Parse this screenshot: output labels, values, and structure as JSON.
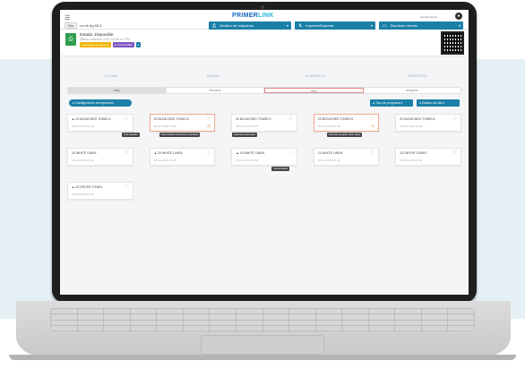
{
  "app": {
    "brand_prefix": "PRIMER",
    "brand_suffix": "LINK",
    "user_name": "Usuario Demo",
    "user_initial": "●"
  },
  "toolbar": {
    "store_label": "Sitio",
    "store_value": "La de Ag 80.4",
    "buttons": [
      {
        "label": "Gestión de máquinas",
        "icon": "printer-icon"
      },
      {
        "label": "Importar/Exportar",
        "icon": "exchange-icon"
      },
      {
        "label": "Escritorio remoto",
        "icon": "monitor-icon"
      }
    ]
  },
  "status": {
    "title": "Estado: Disponible",
    "subtitle": "Última conexión 2021-02-05 a 4 PM",
    "badges": [
      {
        "label": "● Etiquetas de ejemplo",
        "color": "#f4b400"
      },
      {
        "label": "● Cola de PED",
        "color": "#7e57c2"
      },
      {
        "label": "●",
        "color": "#1b7fa8"
      }
    ]
  },
  "sections": [
    "COCINA",
    "MENÚS",
    "ALIMENTOS",
    "REPORTES"
  ],
  "tabs": [
    {
      "label": "Hoy",
      "state": "active"
    },
    {
      "label": "Semana",
      "state": ""
    },
    {
      "label": "Mes",
      "state": "sel"
    },
    {
      "label": "Antiguas",
      "state": ""
    }
  ],
  "actions": {
    "config_button": "● Configuración de impresión",
    "right_buttons": [
      "● Tipo de programa ▾",
      "● Estado del día ▾"
    ]
  },
  "labels": [
    {
      "name": "▲ 20 BLEACHED TOWELS",
      "date": "28 Oct 2019 07:48",
      "icon": "♡",
      "alert": false,
      "tip": "Cola atrasada"
    },
    {
      "name": "20 BLEACHED TOWELS",
      "date": "28 Oct 2019 07:48",
      "icon": "♡",
      "alert": true,
      "tip": "Cola enviada manualmente aprobado"
    },
    {
      "name": "20 BLEACHED TOWELS",
      "date": "28 Oct 2019 07:48",
      "icon": "♡",
      "alert": false,
      "tip": "Esperando impresión"
    },
    {
      "name": "20 BLEACHED TOWELS",
      "date": "28 Oct 2019 07:48",
      "icon": "♡",
      "alert": true,
      "tip": "Cola falta recogida, faltan del(e)"
    },
    {
      "name": "20 BLEACHED TOWELS",
      "date": "28 Oct 2019 07:48",
      "icon": "♡",
      "alert": false,
      "tip": ""
    },
    {
      "name": "20 WHITE LINEN",
      "date": "28 Oct 2019 07:48",
      "icon": "♡",
      "alert": false,
      "tip": ""
    },
    {
      "name": "▲ 20 WHITE LINEN",
      "date": "28 Oct 2019 07:48",
      "icon": "♡",
      "alert": false,
      "tip": ""
    },
    {
      "name": "▲ 20 WHITE LINEN",
      "date": "28 Oct 2019 07:48",
      "icon": "♡",
      "alert": false,
      "tip": "Cola atrasada"
    },
    {
      "name": "20 WHITE LINEN",
      "date": "28 Oct 2019 07:48",
      "icon": "♡",
      "alert": false,
      "tip": ""
    },
    {
      "name": "20 DRYER TOWEL",
      "date": "28 Oct 2019 07:48",
      "icon": "♡",
      "alert": false,
      "tip": ""
    },
    {
      "name": "▲ 20 DRYER TOWEL",
      "date": "28 Oct 2019 07:48",
      "icon": "♡",
      "alert": false,
      "tip": ""
    }
  ],
  "colors": {
    "accent": "#1b7fa8",
    "brand": "#1565c0",
    "ok": "#2e9e4f",
    "alert": "#e0833c"
  }
}
